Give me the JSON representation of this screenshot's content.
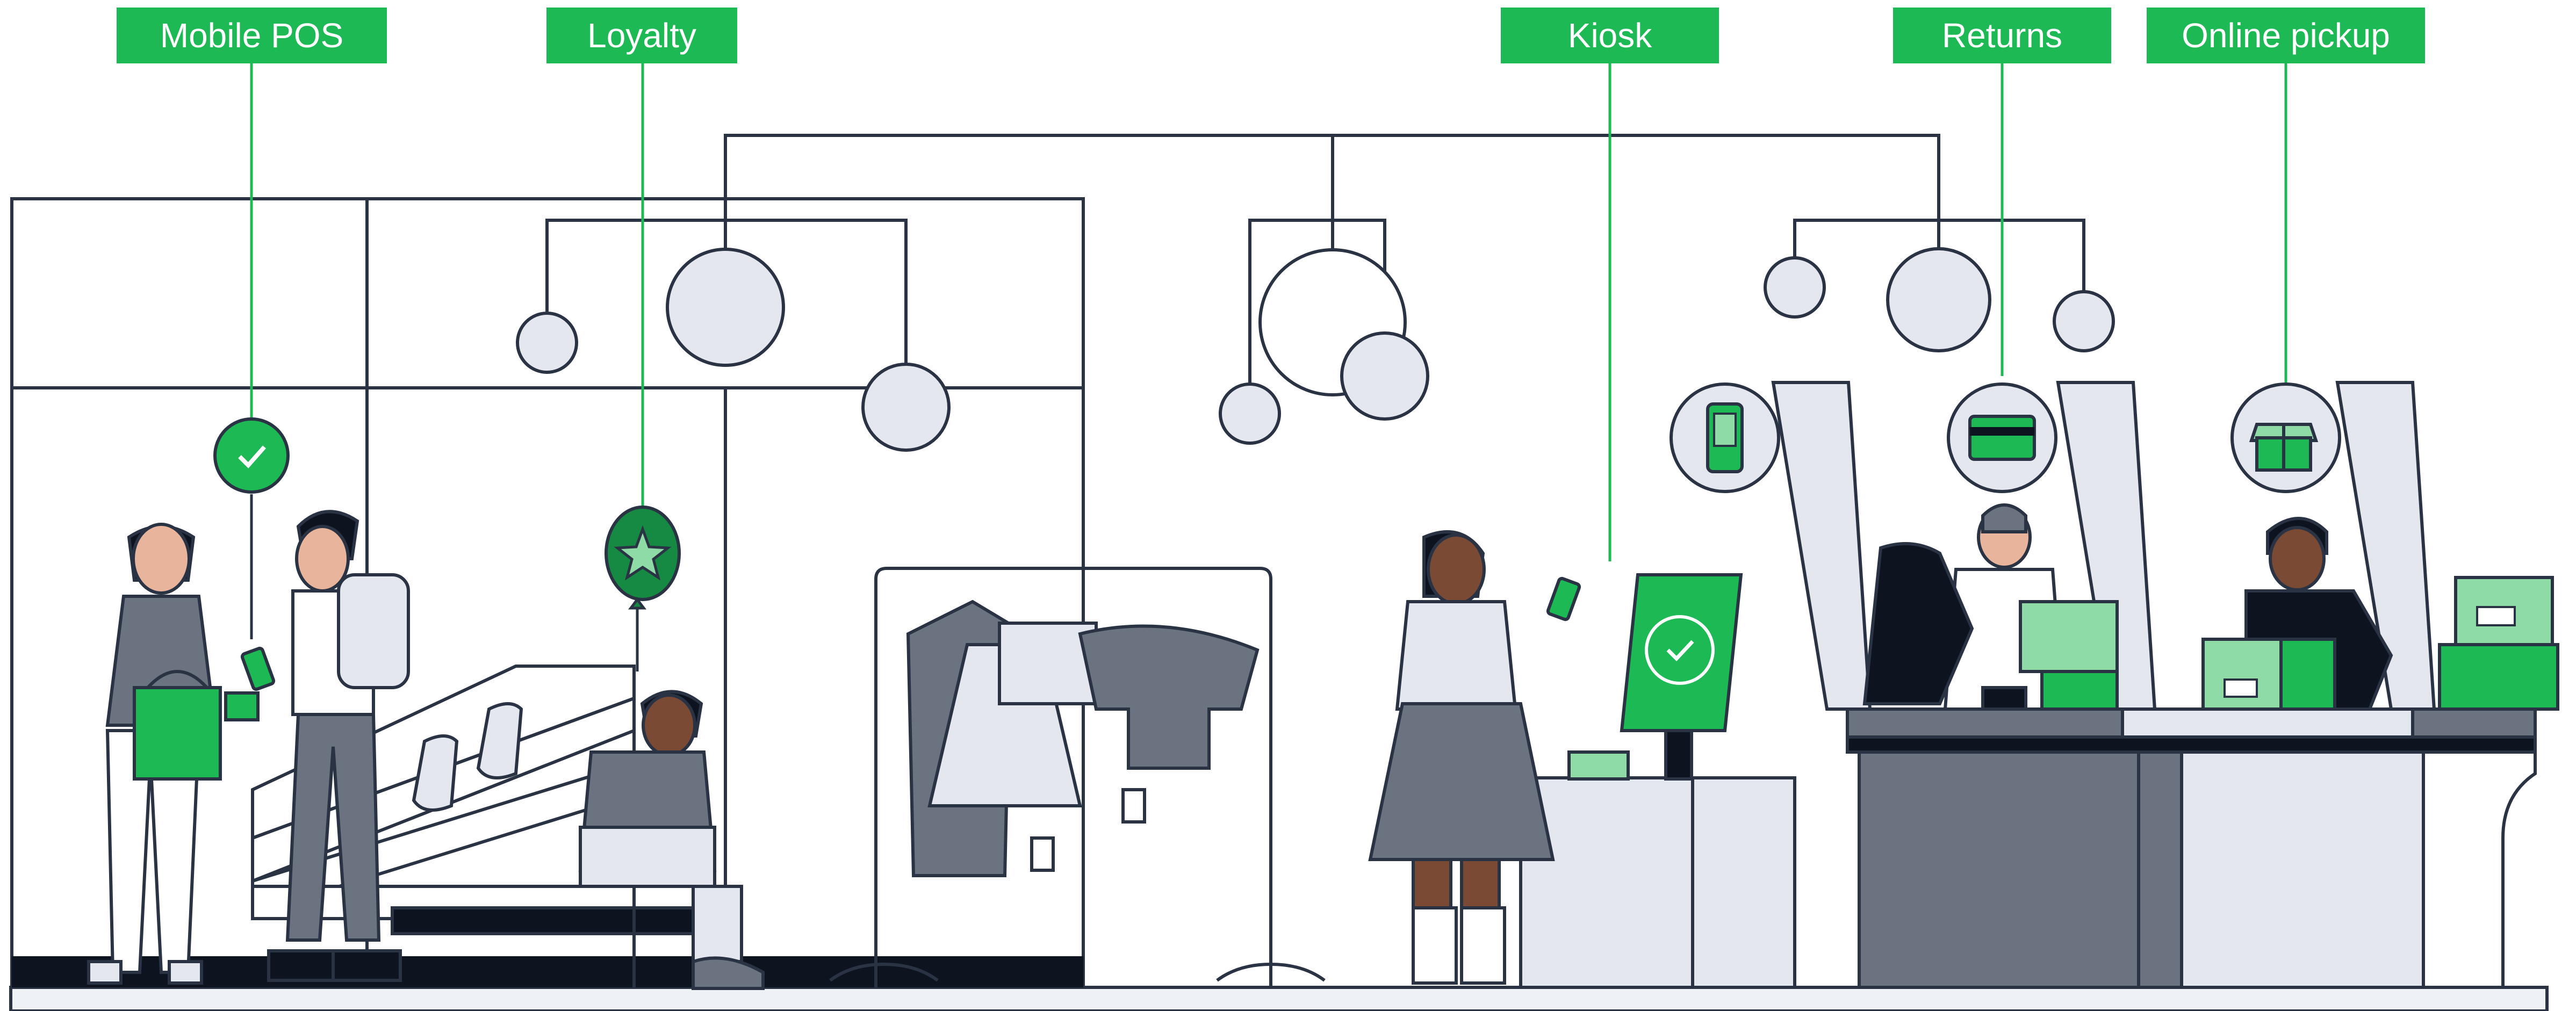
{
  "callouts": [
    {
      "id": "mobile-pos",
      "label": "Mobile POS"
    },
    {
      "id": "loyalty",
      "label": "Loyalty"
    },
    {
      "id": "kiosk",
      "label": "Kiosk"
    },
    {
      "id": "returns",
      "label": "Returns"
    },
    {
      "id": "online-pickup",
      "label": "Online pickup"
    }
  ],
  "colors": {
    "accent": "#1db954",
    "accent_light": "#8fdba5",
    "accent_dark": "#168a43",
    "line": "#2a3344",
    "fill_light": "#e4e7ee",
    "fill_mid": "#6b7280",
    "floor": "#eef1f6",
    "skin_dark": "#7a4a35",
    "skin_light": "#e8b49b"
  }
}
